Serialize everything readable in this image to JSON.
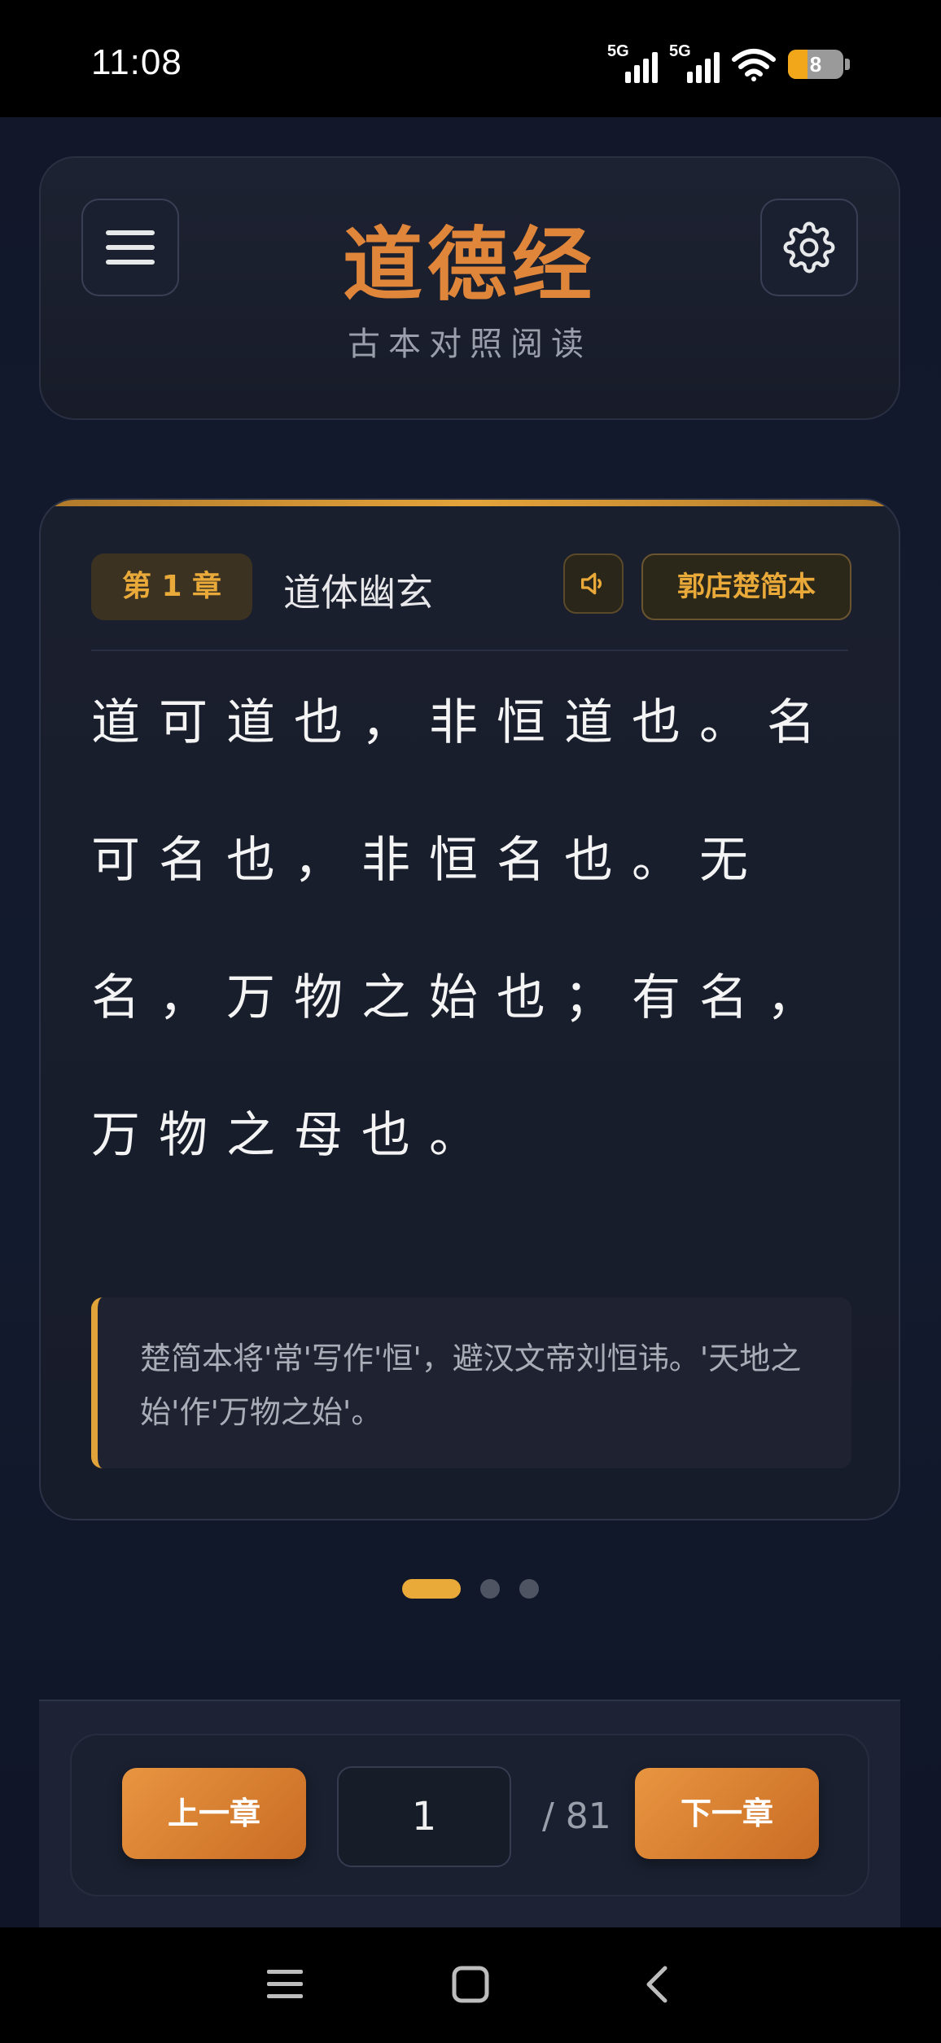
{
  "status_bar": {
    "time": "11:08",
    "signal1_label": "5G",
    "signal2_label": "5G",
    "battery_level": "8",
    "battery_fraction": 0.35
  },
  "header": {
    "title": "道德经",
    "subtitle": "古本对照阅读",
    "menu_icon": "hamburger-icon",
    "settings_icon": "gear-icon"
  },
  "chapter": {
    "badge": "第 1 章",
    "name": "道体幽玄",
    "audio_icon": "speaker-icon",
    "version": "郭店楚简本",
    "text": "道可道也，非恒道也。名可名也，非恒名也。无名，万物之始也；有名，万物之母也。",
    "note": "楚简本将'常'写作'恒'，避汉文帝刘恒讳。'天地之始'作'万物之始'。"
  },
  "pagination": {
    "dots": 3,
    "active_dot": 0
  },
  "navigation": {
    "prev_label": "上一章",
    "next_label": "下一章",
    "current_page": "1",
    "total_pages": "/ 81"
  },
  "colors": {
    "accent": "#e0863a",
    "gold": "#e9aa3a",
    "background": "#131a2e"
  }
}
